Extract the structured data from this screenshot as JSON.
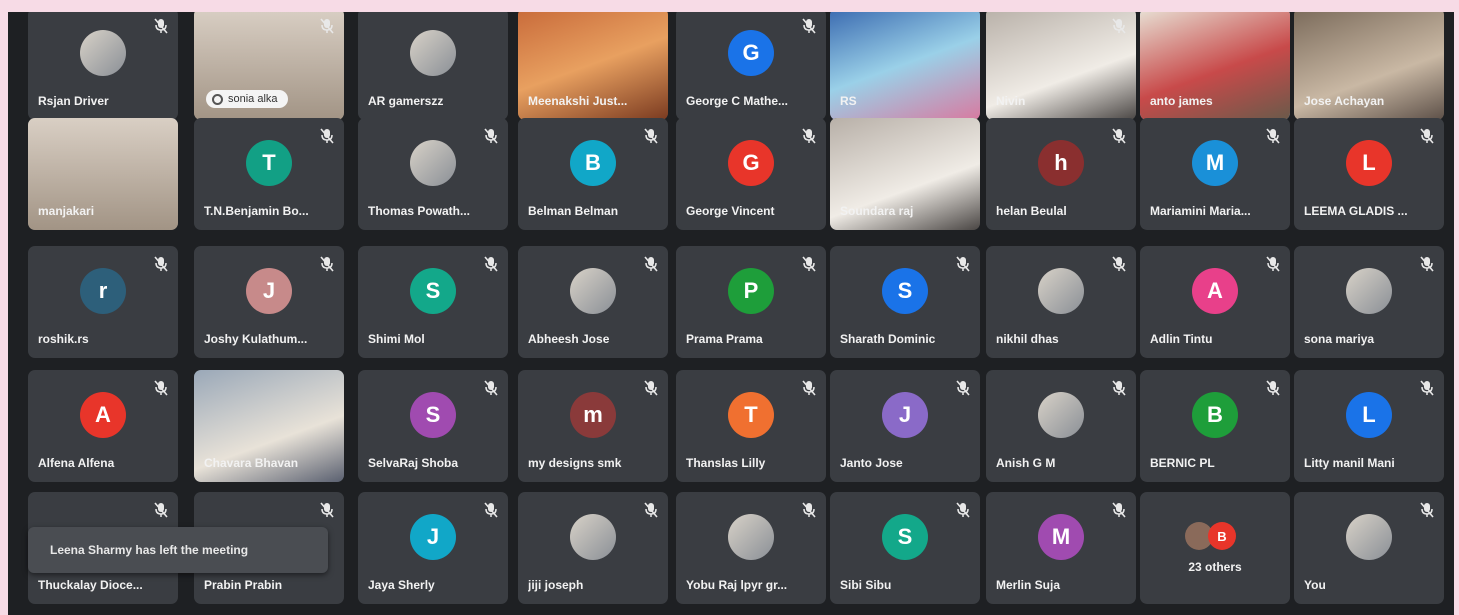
{
  "notification": "Leena Sharmy has left the meeting",
  "participants": [
    {
      "name": "Rsjan Driver",
      "kind": "photo",
      "muted": true
    },
    {
      "name": "",
      "kind": "video",
      "muted": true,
      "pill": "sonia alka"
    },
    {
      "name": "AR gamerszz",
      "kind": "photo",
      "muted": false
    },
    {
      "name": "Meenakshi Just...",
      "kind": "video",
      "muted": false
    },
    {
      "name": "George C Mathe...",
      "kind": "letter",
      "letter": "G",
      "color": "#1a73e8",
      "muted": true
    },
    {
      "name": "RS",
      "kind": "video",
      "muted": false
    },
    {
      "name": "Nivin",
      "kind": "video",
      "muted": true
    },
    {
      "name": "anto james",
      "kind": "video",
      "muted": false,
      "speaking": true
    },
    {
      "name": "Jose Achayan",
      "kind": "video",
      "muted": false
    },
    {
      "name": "manjakari",
      "kind": "video",
      "muted": false
    },
    {
      "name": "T.N.Benjamin Bo...",
      "kind": "letter",
      "letter": "T",
      "color": "#12a085",
      "muted": true
    },
    {
      "name": "Thomas Powath...",
      "kind": "photo",
      "muted": true
    },
    {
      "name": "Belman Belman",
      "kind": "letter",
      "letter": "B",
      "color": "#11a7c8",
      "muted": true
    },
    {
      "name": "George Vincent",
      "kind": "letter",
      "letter": "G",
      "color": "#e8352a",
      "muted": true
    },
    {
      "name": "Soundara raj",
      "kind": "video",
      "muted": false
    },
    {
      "name": "helan Beulal",
      "kind": "letter",
      "letter": "h",
      "color": "#8a2f2f",
      "muted": true
    },
    {
      "name": "Mariamini Maria...",
      "kind": "letter",
      "letter": "M",
      "color": "#1a90d8",
      "muted": true
    },
    {
      "name": "LEEMA GLADIS ...",
      "kind": "letter",
      "letter": "L",
      "color": "#e8352a",
      "muted": true
    },
    {
      "name": "roshik.rs",
      "kind": "letter",
      "letter": "r",
      "color": "#2d5f7a",
      "muted": true
    },
    {
      "name": "Joshy Kulathum...",
      "kind": "letter",
      "letter": "J",
      "color": "#c78a8a",
      "muted": true
    },
    {
      "name": "Shimi Mol",
      "kind": "letter",
      "letter": "S",
      "color": "#13a88a",
      "muted": true
    },
    {
      "name": "Abheesh Jose",
      "kind": "photo",
      "muted": true
    },
    {
      "name": "Prama Prama",
      "kind": "letter",
      "letter": "P",
      "color": "#1e9e3a",
      "muted": true
    },
    {
      "name": "Sharath Dominic",
      "kind": "letter",
      "letter": "S",
      "color": "#1a73e8",
      "muted": true
    },
    {
      "name": "nikhil dhas",
      "kind": "photo",
      "muted": true
    },
    {
      "name": "Adlin Tintu",
      "kind": "letter",
      "letter": "A",
      "color": "#e8408a",
      "muted": true
    },
    {
      "name": "sona mariya",
      "kind": "photo",
      "muted": true
    },
    {
      "name": "Alfena Alfena",
      "kind": "letter",
      "letter": "A",
      "color": "#e8352a",
      "muted": true
    },
    {
      "name": "Chavara Bhavan",
      "kind": "video",
      "muted": false
    },
    {
      "name": "SelvaRaj Shoba",
      "kind": "letter",
      "letter": "S",
      "color": "#a04bb0",
      "muted": true
    },
    {
      "name": "my designs smk",
      "kind": "letter",
      "letter": "m",
      "color": "#8a3a3a",
      "muted": true
    },
    {
      "name": "Thanslas Lilly",
      "kind": "letter",
      "letter": "T",
      "color": "#f07030",
      "muted": true
    },
    {
      "name": "Janto Jose",
      "kind": "letter",
      "letter": "J",
      "color": "#8a6ac8",
      "muted": true
    },
    {
      "name": "Anish G M",
      "kind": "photo",
      "muted": true
    },
    {
      "name": "BERNIC PL",
      "kind": "letter",
      "letter": "B",
      "color": "#1e9e3a",
      "muted": true
    },
    {
      "name": "Litty manil Mani",
      "kind": "letter",
      "letter": "L",
      "color": "#1a73e8",
      "muted": true
    },
    {
      "name": "Thuckalay Dioce...",
      "kind": "blank",
      "muted": true
    },
    {
      "name": "Prabin Prabin",
      "kind": "blank",
      "muted": true
    },
    {
      "name": "Jaya Sherly",
      "kind": "letter",
      "letter": "J",
      "color": "#11a7c8",
      "muted": true
    },
    {
      "name": "jiji joseph",
      "kind": "photo",
      "muted": true
    },
    {
      "name": "Yobu Raj lpyr gr...",
      "kind": "photo",
      "muted": true
    },
    {
      "name": "Sibi Sibu",
      "kind": "letter",
      "letter": "S",
      "color": "#13a88a",
      "muted": true
    },
    {
      "name": "Merlin Suja",
      "kind": "letter",
      "letter": "M",
      "color": "#a04bb0",
      "muted": true
    },
    {
      "name": "23 others",
      "kind": "others",
      "muted": false
    },
    {
      "name": "You",
      "kind": "photo",
      "muted": true
    }
  ],
  "colors": {
    "background": "#1e2023",
    "tile": "#3a3d42",
    "speaking": "#5aa0f0"
  }
}
